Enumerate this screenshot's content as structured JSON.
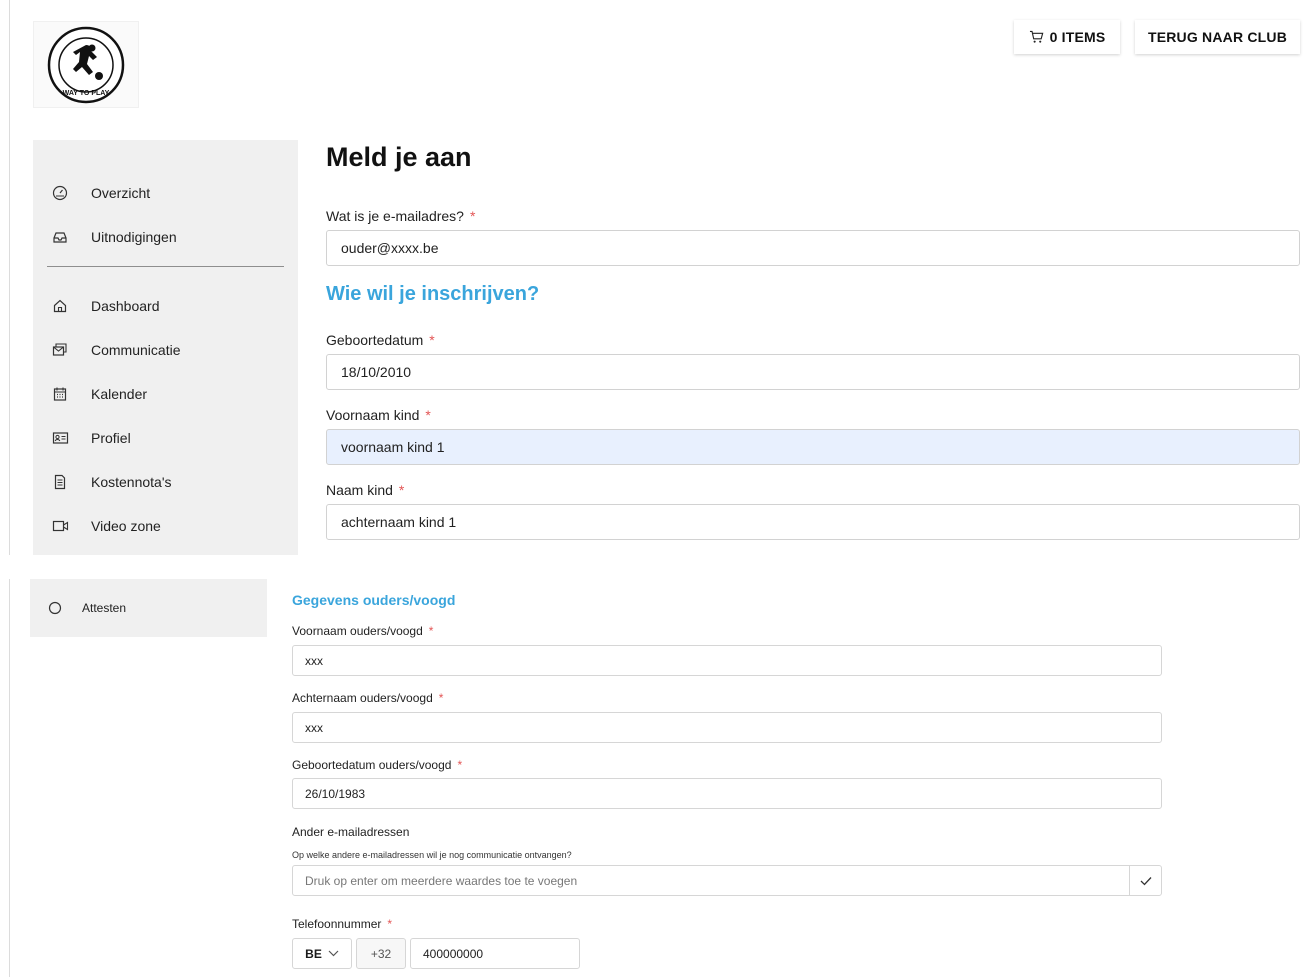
{
  "header": {
    "cart_label": "0 ITEMS",
    "back_label": "TERUG NAAR CLUB",
    "logo_icon": "way-to-play-logo",
    "logo_text": "WAY TO PLAY"
  },
  "sidebar": {
    "items": [
      {
        "label": "Overzicht",
        "icon": "dashboard-gauge-icon"
      },
      {
        "label": "Uitnodigingen",
        "icon": "inbox-icon"
      },
      {
        "label": "Dashboard",
        "icon": "home-icon"
      },
      {
        "label": "Communicatie",
        "icon": "messages-icon"
      },
      {
        "label": "Kalender",
        "icon": "calendar-icon"
      },
      {
        "label": "Profiel",
        "icon": "id-card-icon"
      },
      {
        "label": "Kostennota's",
        "icon": "receipt-icon"
      },
      {
        "label": "Video zone",
        "icon": "video-icon"
      }
    ],
    "extra_item": {
      "label": "Attesten",
      "icon": "circle-icon"
    }
  },
  "form": {
    "title": "Meld je aan",
    "email_label": "Wat is je e-mailadres?",
    "email_value": "ouder@xxxx.be",
    "section_title": "Wie wil je inschrijven?",
    "birthdate_label": "Geboortedatum",
    "birthdate_value": "18/10/2010",
    "firstname_label": "Voornaam kind",
    "firstname_value": "voornaam kind 1",
    "lastname_label": "Naam kind",
    "lastname_value": "achternaam kind 1",
    "required_mark": "*"
  },
  "parents": {
    "section_title": "Gegevens ouders/voogd",
    "firstname_label": "Voornaam ouders/voogd",
    "firstname_value": "xxx",
    "lastname_label": "Achternaam ouders/voogd",
    "lastname_value": "xxx",
    "birthdate_label": "Geboortedatum ouders/voogd",
    "birthdate_value": "26/10/1983",
    "other_emails_label": "Ander e-mailadressen",
    "other_emails_hint": "Op welke andere e-mailadressen wil je nog communicatie ontvangen?",
    "other_emails_placeholder": "Druk op enter om meerdere waardes toe te voegen",
    "phone_label": "Telefoonnummer",
    "country_code": "BE",
    "dial_code": "+32",
    "phone_value": "400000000"
  },
  "colors": {
    "accent": "#3aa5dc",
    "required": "#e35555",
    "sidebar_bg": "#f0f0f0",
    "autofill_bg": "#e8f0fe"
  }
}
